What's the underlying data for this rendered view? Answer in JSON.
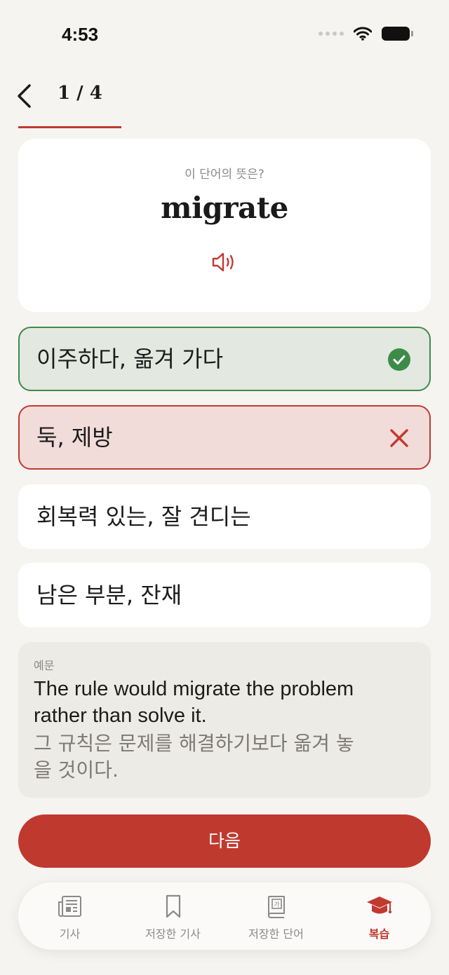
{
  "status_bar": {
    "time": "4:53"
  },
  "header": {
    "progress": "1 / 4",
    "progress_fraction": 0.25
  },
  "card": {
    "prompt": "이 단어의 뜻은?",
    "word": "migrate"
  },
  "options": [
    {
      "text": "이주하다, 옮겨 가다",
      "state": "correct"
    },
    {
      "text": "둑, 제방",
      "state": "wrong"
    },
    {
      "text": "회복력 있는, 잘 견디는",
      "state": "neutral"
    },
    {
      "text": "남은 부분, 잔재",
      "state": "neutral"
    }
  ],
  "example": {
    "label": "예문",
    "english": "The rule would migrate the problem rather than solve it.",
    "korean": "그 규칙은 문제를 해결하기보다 옮겨 놓을 것이다."
  },
  "next_button": {
    "label": "다음"
  },
  "tabs": [
    {
      "label": "기사",
      "icon": "newspaper-icon",
      "active": false
    },
    {
      "label": "저장한 기사",
      "icon": "bookmark-icon",
      "active": false
    },
    {
      "label": "저장한 단어",
      "icon": "word-book-icon",
      "active": false
    },
    {
      "label": "복습",
      "icon": "graduation-cap-icon",
      "active": true
    }
  ],
  "colors": {
    "accent": "#c0392f",
    "correct": "#3d8b48",
    "correct_bg": "#e3e8e0",
    "wrong_bg": "#f1dcd9",
    "background": "#f6f4f0"
  }
}
